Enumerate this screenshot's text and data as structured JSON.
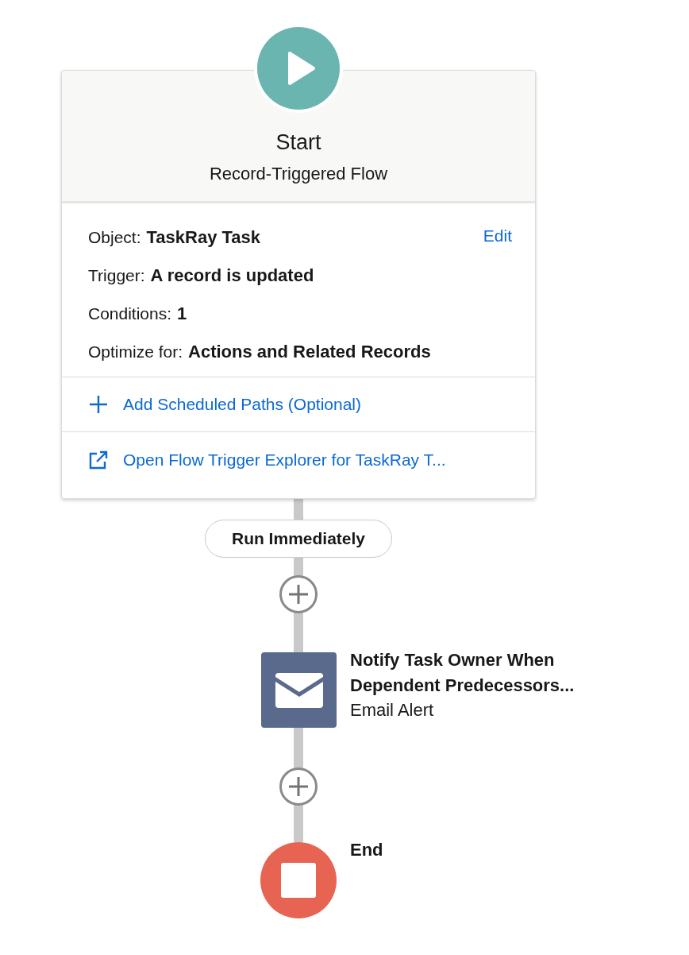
{
  "start": {
    "title": "Start",
    "subtitle": "Record-Triggered Flow",
    "edit_link": "Edit",
    "details": [
      {
        "label": "Object:",
        "value": "TaskRay Task"
      },
      {
        "label": "Trigger:",
        "value": "A record is updated"
      },
      {
        "label": "Conditions:",
        "value": "1"
      },
      {
        "label": "Optimize for:",
        "value": "Actions and Related Records"
      }
    ],
    "actions": [
      {
        "kind": "add",
        "label": "Add Scheduled Paths (Optional)"
      },
      {
        "kind": "open",
        "label": "Open Flow Trigger Explorer for TaskRay T..."
      }
    ]
  },
  "path_label": "Run Immediately",
  "elements": [
    {
      "kind": "email",
      "title": "Notify Task Owner When Dependent Predecessors...",
      "type": "Email Alert"
    }
  ],
  "end": {
    "label": "End"
  }
}
